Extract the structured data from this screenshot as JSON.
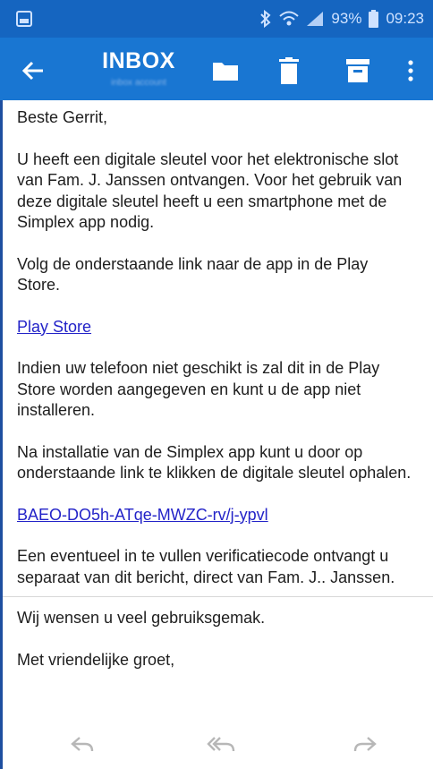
{
  "status_bar": {
    "battery": "93%",
    "time": "09:23",
    "icons": [
      "notification-icon",
      "bluetooth-icon",
      "wifi-icon",
      "signal-icon",
      "battery-icon"
    ]
  },
  "toolbar": {
    "title": "INBOX",
    "subtitle": "inbox account",
    "actions": [
      "back-arrow-icon",
      "folder-icon",
      "delete-icon",
      "archive-icon",
      "more-vert-icon"
    ]
  },
  "email": {
    "greeting": "Beste Gerrit,",
    "para1": "U heeft een digitale sleutel voor het elektronische slot van Fam. J. Janssen ontvangen. Voor het gebruik van deze digitale sleutel heeft u een smartphone met de Simplex app nodig.",
    "para2": "Volg de onderstaande link naar de app in de Play Store.",
    "link1": "Play Store",
    "para3": "Indien uw telefoon niet geschikt is zal dit in de Play Store worden aangegeven en kunt u de app niet installeren.",
    "para4": "Na installatie van de Simplex app kunt u door op onderstaande link te klikken de digitale sleutel ophalen.",
    "link2": "BAEO-DO5h-ATqe-MWZC-rv/j-ypvl",
    "para5": "Een eventueel in te vullen verificatiecode ontvangt u separaat van dit bericht, direct van Fam. J.. Janssen.",
    "para6": "Wij wensen u veel gebruiksgemak.",
    "closing": "Met vriendelijke groet,"
  },
  "bottom_actions": [
    "reply-icon",
    "reply-all-icon",
    "forward-icon"
  ],
  "colors": {
    "status_bar": "#1565c0",
    "app_bar": "#1976d2",
    "link": "#2323c8",
    "left_border": "#1e4fa0"
  }
}
